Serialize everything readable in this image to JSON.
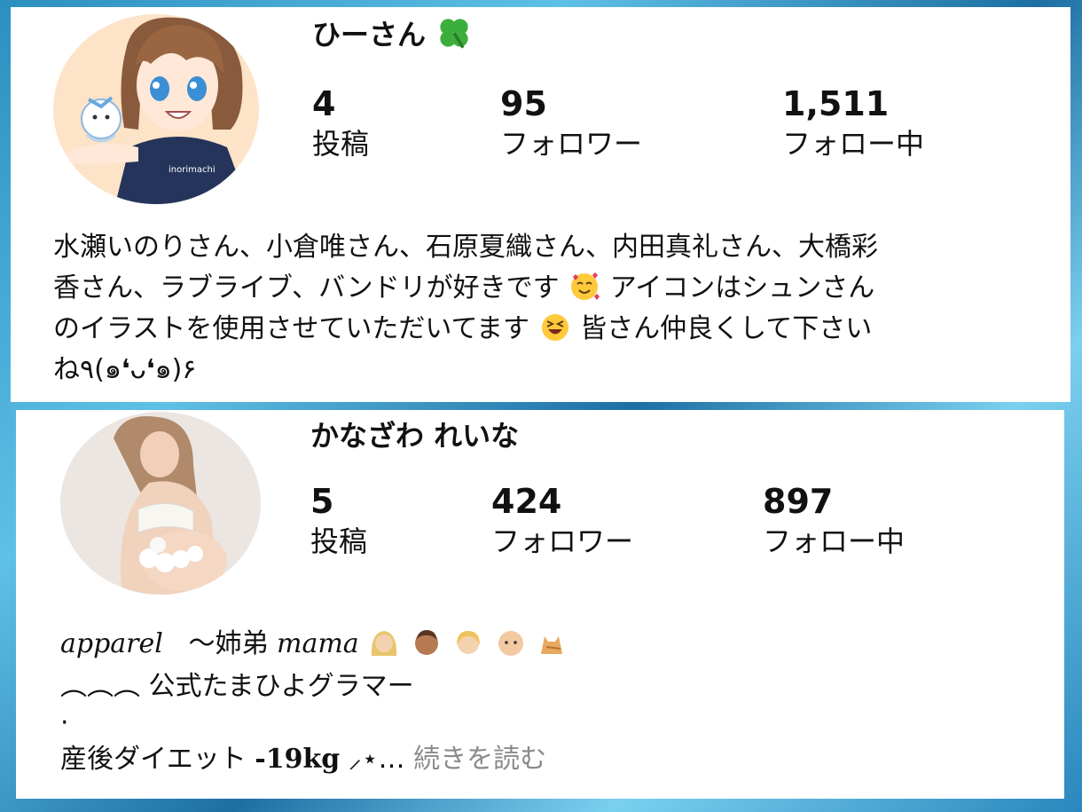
{
  "profiles": [
    {
      "username": "ひーさん",
      "username_emoji": "four-leaf-clover-icon",
      "avatar_label": "inorimachi",
      "stats": [
        {
          "value": "4",
          "label": "投稿"
        },
        {
          "value": "95",
          "label": "フォロワー"
        },
        {
          "value": "1,511",
          "label": "フォロー中"
        }
      ],
      "bio_lines": [
        "水瀬いのりさん、小倉唯さん、石原夏織さん、内田真礼さん、大橋彩",
        "香さん、ラブライブ、バンドリが好きです",
        "アイコンはシュンさん",
        "のイラストを使用させていただいてます",
        "皆さん仲良くして下さい",
        "ね٩(๑❛ᴗ❛๑)۶"
      ]
    },
    {
      "username": "かなざわ れいな",
      "stats": [
        {
          "value": "5",
          "label": "投稿"
        },
        {
          "value": "424",
          "label": "フォロワー"
        },
        {
          "value": "897",
          "label": "フォロー中"
        }
      ],
      "bio_lines": [
        "apparel",
        "〜姉弟",
        "mama",
        "︵︵︵",
        "公式たまひよグラマー",
        "·",
        "産後ダイエット",
        "-19kg",
        "⸝⋆…",
        "続きを読む"
      ]
    }
  ],
  "colors": {
    "text": "#111111",
    "more_link": "#8a8a8a",
    "card_bg": "#ffffff"
  }
}
